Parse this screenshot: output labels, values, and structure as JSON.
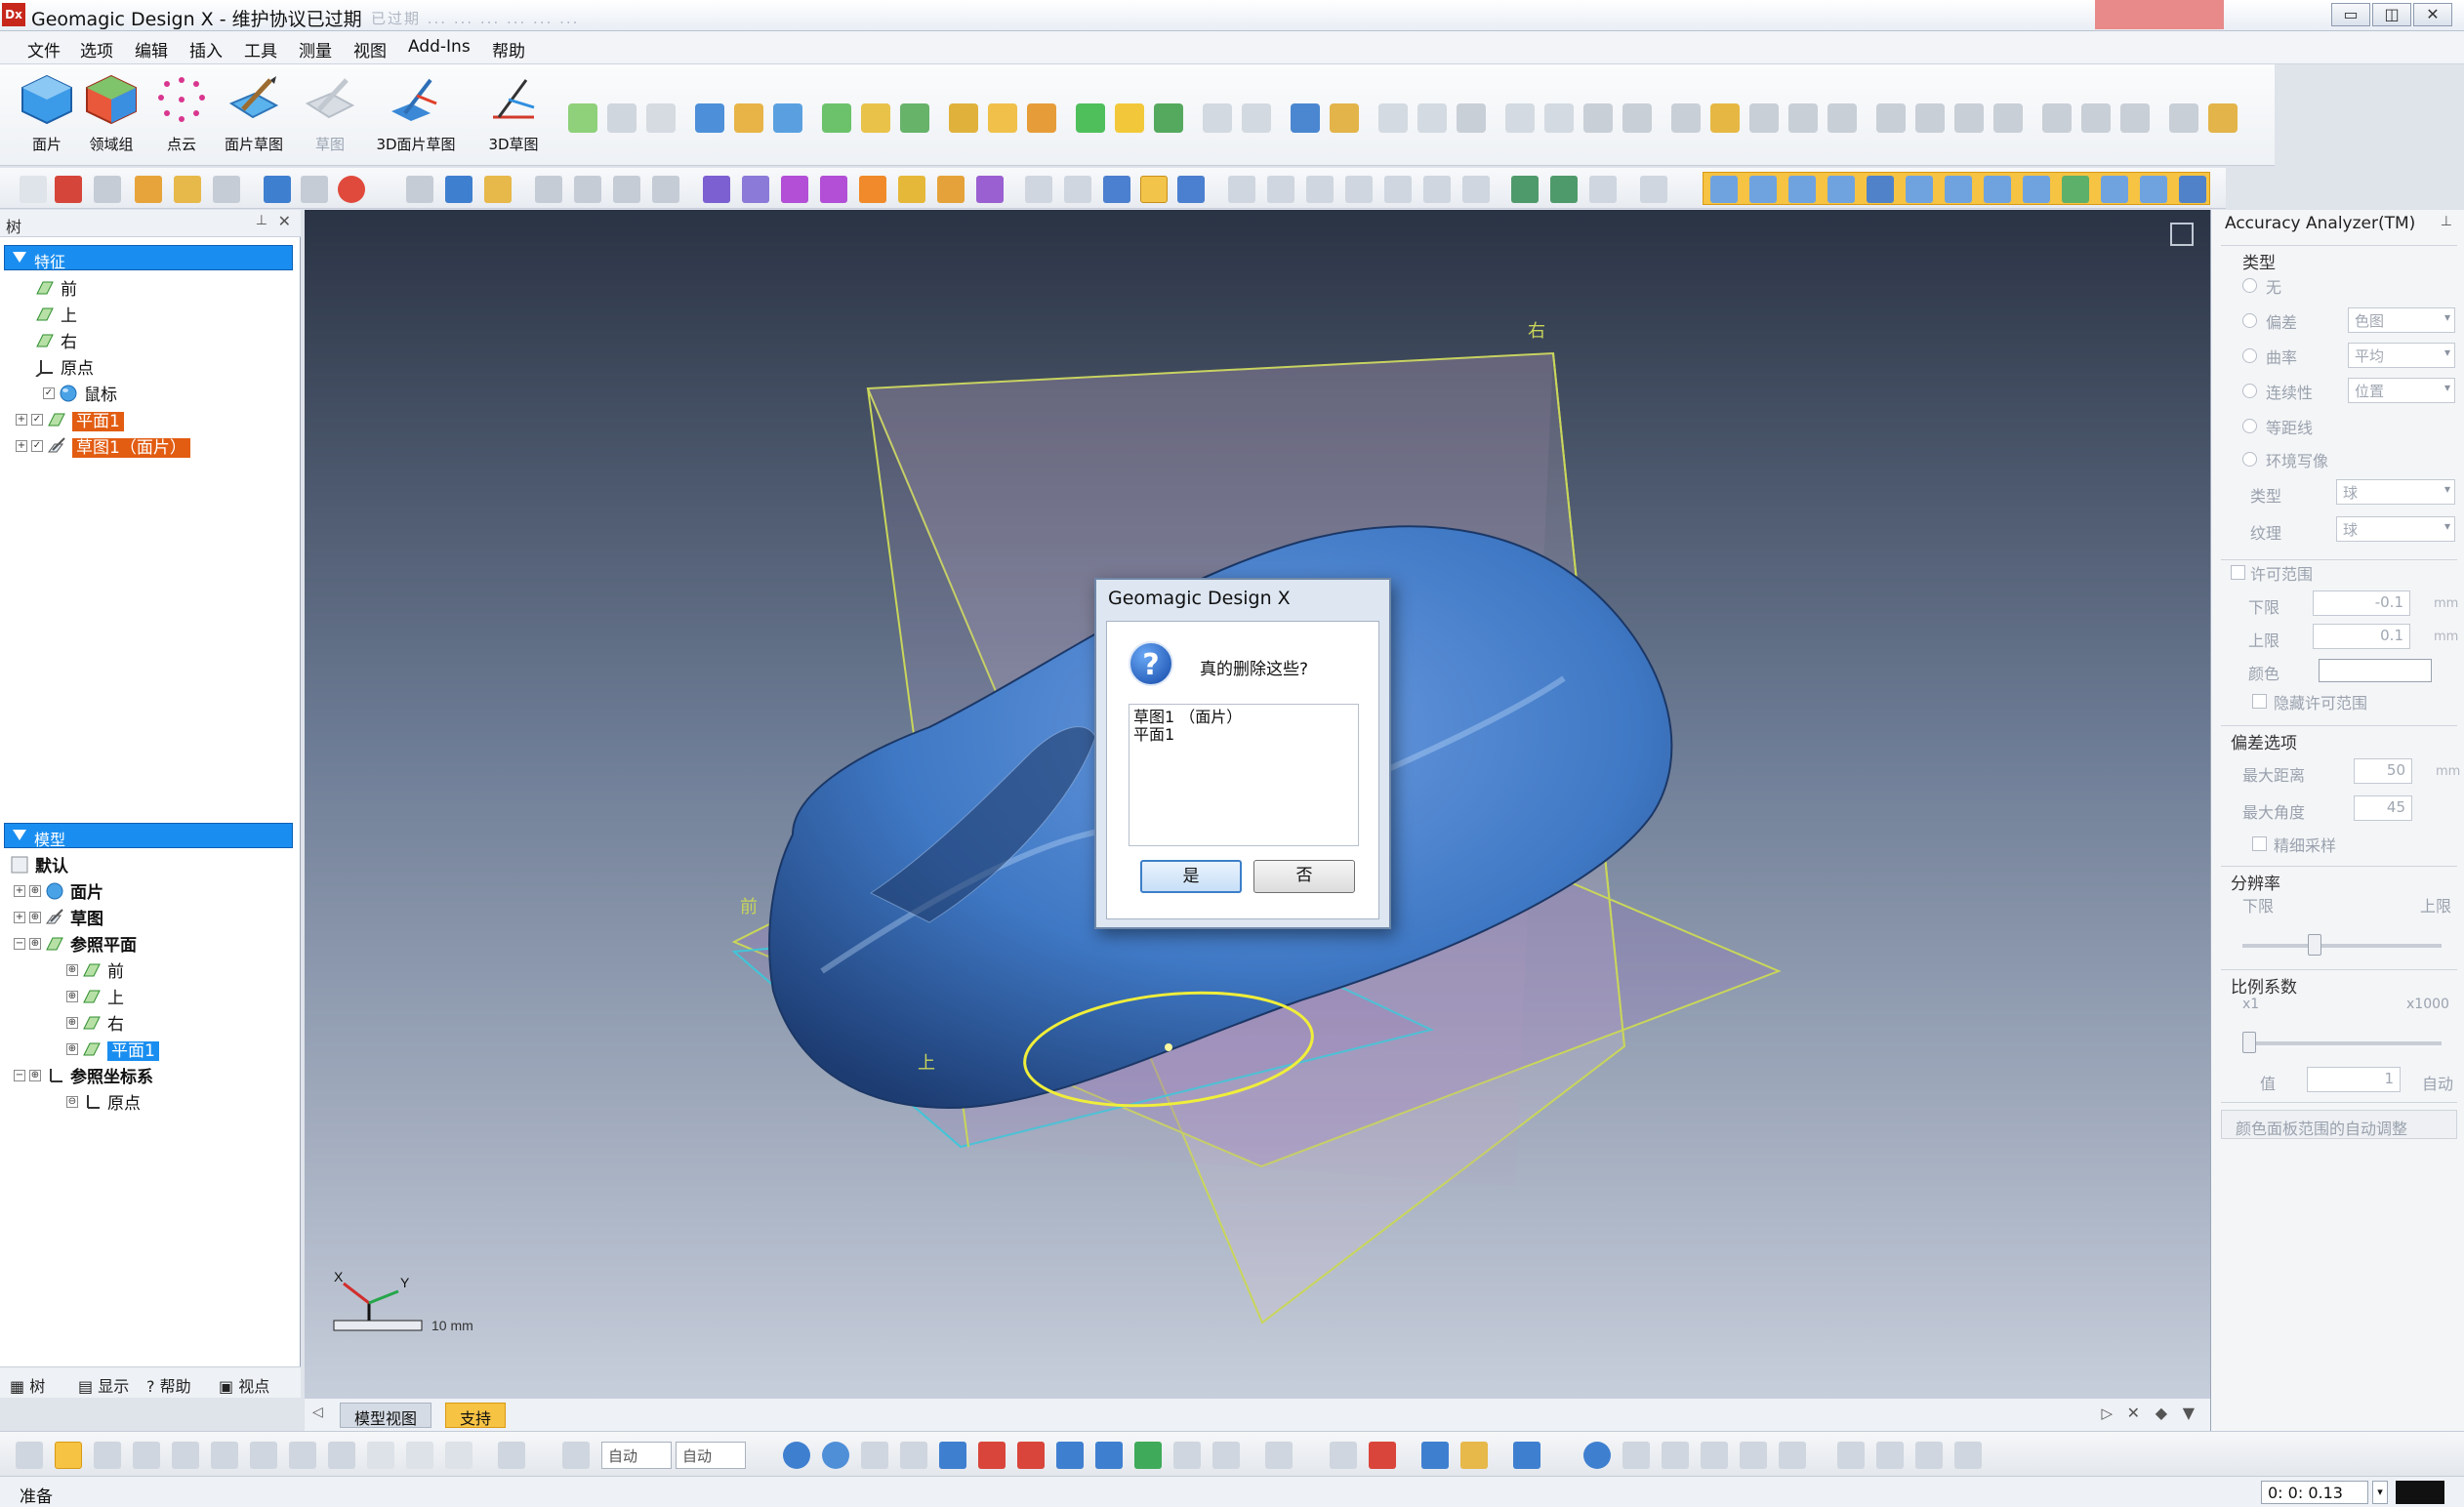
{
  "window": {
    "app_icon": "Dx",
    "title": "Geomagic Design X - 维护协议已过期",
    "faded_title_tail": "已过期 ... ... ... ... ... ...",
    "minimize": "▭",
    "restore": "◫",
    "close": "✕"
  },
  "menu": [
    "文件",
    "选项",
    "编辑",
    "插入",
    "工具",
    "测量",
    "视图",
    "Add-Ins",
    "帮助"
  ],
  "ribbon": {
    "big_tools": [
      {
        "label": "面片",
        "icon": "mesh-hexagon-icon",
        "color": "#2e8fe0"
      },
      {
        "label": "领域组",
        "icon": "region-group-icon",
        "color": "#e24a2b"
      },
      {
        "label": "点云",
        "icon": "point-cloud-icon",
        "color": "#d9368f"
      },
      {
        "label": "面片草图",
        "icon": "mesh-sketch-icon",
        "color": "#3da4e8"
      },
      {
        "label": "草图",
        "icon": "sketch-icon",
        "color": "#bfc6cf",
        "disabled": true
      },
      {
        "label": "3D面片草图",
        "icon": "3d-mesh-sketch-icon",
        "color": "#2e76c9"
      },
      {
        "label": "3D草图",
        "icon": "3d-sketch-icon",
        "color": "#d23a2a"
      }
    ]
  },
  "left_panel": {
    "header": "树",
    "feature_section": "特征",
    "feature_items": [
      {
        "label": "前",
        "icon": "plane-icon"
      },
      {
        "label": "上",
        "icon": "plane-icon"
      },
      {
        "label": "右",
        "icon": "plane-icon"
      },
      {
        "label": "原点",
        "icon": "origin-icon"
      },
      {
        "label": "鼠标",
        "icon": "mesh-ball-icon"
      },
      {
        "label": "平面1",
        "icon": "plane-icon",
        "highlight": "orange"
      },
      {
        "label": "草图1（面片）",
        "icon": "sketch-icon",
        "highlight": "orange"
      }
    ],
    "model_section": "模型",
    "model_items": [
      {
        "label": "默认",
        "icon": "default-icon",
        "indent": 0
      },
      {
        "label": "面片",
        "icon": "mesh-ball-icon",
        "indent": 1
      },
      {
        "label": "草图",
        "icon": "sketch-icon",
        "indent": 1
      },
      {
        "label": "参照平面",
        "icon": "plane-icon",
        "indent": 1
      },
      {
        "label": "前",
        "icon": "plane-icon",
        "indent": 2
      },
      {
        "label": "上",
        "icon": "plane-icon",
        "indent": 2
      },
      {
        "label": "右",
        "icon": "plane-icon",
        "indent": 2
      },
      {
        "label": "平面1",
        "icon": "plane-icon",
        "indent": 2,
        "highlight": "blue"
      },
      {
        "label": "参照坐标系",
        "icon": "origin-icon",
        "indent": 1
      },
      {
        "label": "原点",
        "icon": "origin-icon",
        "indent": 2
      }
    ],
    "bottom_tabs": [
      "树",
      "显示",
      "帮助",
      "视点"
    ]
  },
  "viewport": {
    "label_right": "右",
    "label_front": "前",
    "label_up": "上",
    "scale_text": "10 mm",
    "tabs": [
      "模型视图",
      "支持"
    ],
    "mesh_color": "#3f78c4"
  },
  "dialog": {
    "title": "Geomagic Design X",
    "question": "真的删除这些?",
    "items": [
      "草图1 （面片）",
      "平面1"
    ],
    "yes": "是",
    "no": "否"
  },
  "right_panel": {
    "title": "Accuracy Analyzer(TM)",
    "type_head": "类型",
    "types": [
      "无",
      "偏差",
      "曲率",
      "连续性",
      "等距线",
      "环境写像"
    ],
    "combo_deviation": "色图",
    "combo_curvature": "平均",
    "combo_continuity": "位置",
    "sub_type_label": "类型",
    "sub_type_value": "球",
    "texture_label": "纹理",
    "texture_value": "球",
    "tolerance_head": "许可范围",
    "lower_label": "下限",
    "lower_value": "-0.1",
    "upper_label": "上限",
    "upper_value": "0.1",
    "color_label": "颜色",
    "hide_tolerance": "隐藏许可范围",
    "unit_mm": "mm",
    "deviation_options_head": "偏差选项",
    "max_distance_label": "最大距离",
    "max_distance_value": "50",
    "max_angle_label": "最大角度",
    "max_angle_value": "45",
    "fine_sampling": "精细采样",
    "resolution_head": "分辨率",
    "res_low": "下限",
    "res_high": "上限",
    "res_fraction": 0.35,
    "scale_factor_head": "比例系数",
    "sf_min": "x1",
    "sf_max": "x1000",
    "sf_fraction": 0.0,
    "value_label": "值",
    "value_value": "1",
    "auto_label": "自动",
    "auto_adjust": "颜色面板范围的自动调整"
  },
  "bottom_toolbar": {
    "combo1": "自动",
    "combo2": "自动"
  },
  "status": {
    "text": "准备",
    "time": "0: 0: 0.13"
  }
}
